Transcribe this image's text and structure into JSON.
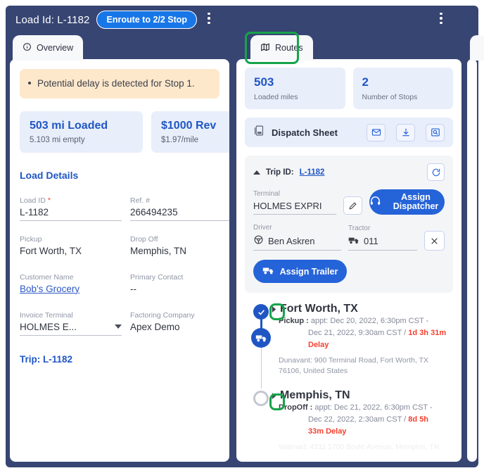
{
  "header": {
    "load_id_text": "Load Id: L-1182",
    "status_pill": "Enroute to 2/2 Stop",
    "kebab_left": "more-options",
    "kebab_right": "more-options"
  },
  "tabs": {
    "overview": {
      "label": "Overview",
      "icon": "info-icon"
    },
    "routes": {
      "label": "Routes",
      "icon": "map-icon"
    }
  },
  "left_panel": {
    "alert": "Potential delay is detected for Stop 1.",
    "stats": [
      {
        "title": "503 mi Loaded",
        "sub": "5.103 mi empty"
      },
      {
        "title": "$1000 Rev",
        "sub": "$1.97/mile"
      }
    ],
    "section_title": "Load Details",
    "fields": [
      {
        "label": "Load ID",
        "required": true,
        "value": "L-1182",
        "underline": true
      },
      {
        "label": "Ref. #",
        "required": false,
        "value": "266494235",
        "underline": true
      },
      {
        "label": "Pickup",
        "required": false,
        "value": "Fort Worth, TX",
        "underline": false
      },
      {
        "label": "Drop Off",
        "required": false,
        "value": "Memphis, TN",
        "underline": false
      },
      {
        "label": "Customer Name",
        "required": false,
        "value": "Bob's Grocery",
        "link": true
      },
      {
        "label": "Primary Contact",
        "required": false,
        "value": "--",
        "underline": false
      },
      {
        "label": "Invoice Terminal",
        "required": false,
        "value": "HOLMES E...",
        "select": true
      },
      {
        "label": "Factoring Company",
        "required": false,
        "value": "Apex Demo",
        "underline": false
      }
    ],
    "trip_link": "Trip: L-1182"
  },
  "right_panel": {
    "stats": [
      {
        "num": "503",
        "label": "Loaded miles"
      },
      {
        "num": "2",
        "label": "Number of Stops"
      }
    ],
    "dispatch": {
      "title": "Dispatch Sheet",
      "icon": "pdf-icon",
      "actions": [
        {
          "name": "email-icon"
        },
        {
          "name": "download-icon"
        },
        {
          "name": "preview-icon"
        }
      ]
    },
    "trip": {
      "head_label": "Trip ID:",
      "head_id": "L-1182",
      "refresh_icon": "refresh-icon",
      "terminal_label": "Terminal",
      "terminal_value": "HOLMES EXPRI",
      "edit_icon": "pencil-icon",
      "assign_dispatcher": "Assign Dispatcher",
      "dispatcher_icon": "headset-icon",
      "driver_label": "Driver",
      "driver_value": "Ben Askren",
      "driver_icon": "steering-wheel-icon",
      "tractor_label": "Tractor",
      "tractor_value": "011",
      "tractor_icon": "truck-icon",
      "clear_icon": "close-icon",
      "assign_trailer": "Assign Trailer",
      "trailer_icon": "truck-icon"
    },
    "stops": [
      {
        "title": "Fort Worth, TX",
        "type_label": "Pickup :",
        "appt_line1": "appt: Dec 20, 2022, 6:30pm CST  -",
        "appt_line2": "Dec 21, 2022, 9:30am CST",
        "duration": "1d 3h 31m",
        "delay": "Delay",
        "address": "Dunavant: 900 Terminal Road, Fort Worth, TX 76106, United States",
        "marker": "completed"
      },
      {
        "title": "Memphis, TN",
        "type_label": "DropOff :",
        "appt_line1": "appt: Dec 21, 2022, 6:30pm CST  -",
        "appt_line2": "Dec 22, 2022, 2:30am CST",
        "duration": "8d 5h",
        "delay": "33m Delay",
        "address": "Walmart: 4311 1700 Boyle Avenue, Memphis, TN",
        "marker": "pending"
      }
    ]
  },
  "colors": {
    "navy": "#374573",
    "blue": "#1f56c4",
    "accent_blue": "#1877e8",
    "alert_bg": "#fde8cc",
    "stat_bg": "#e9eefb",
    "red": "#f43f2e",
    "highlight_green": "#16a34a"
  }
}
